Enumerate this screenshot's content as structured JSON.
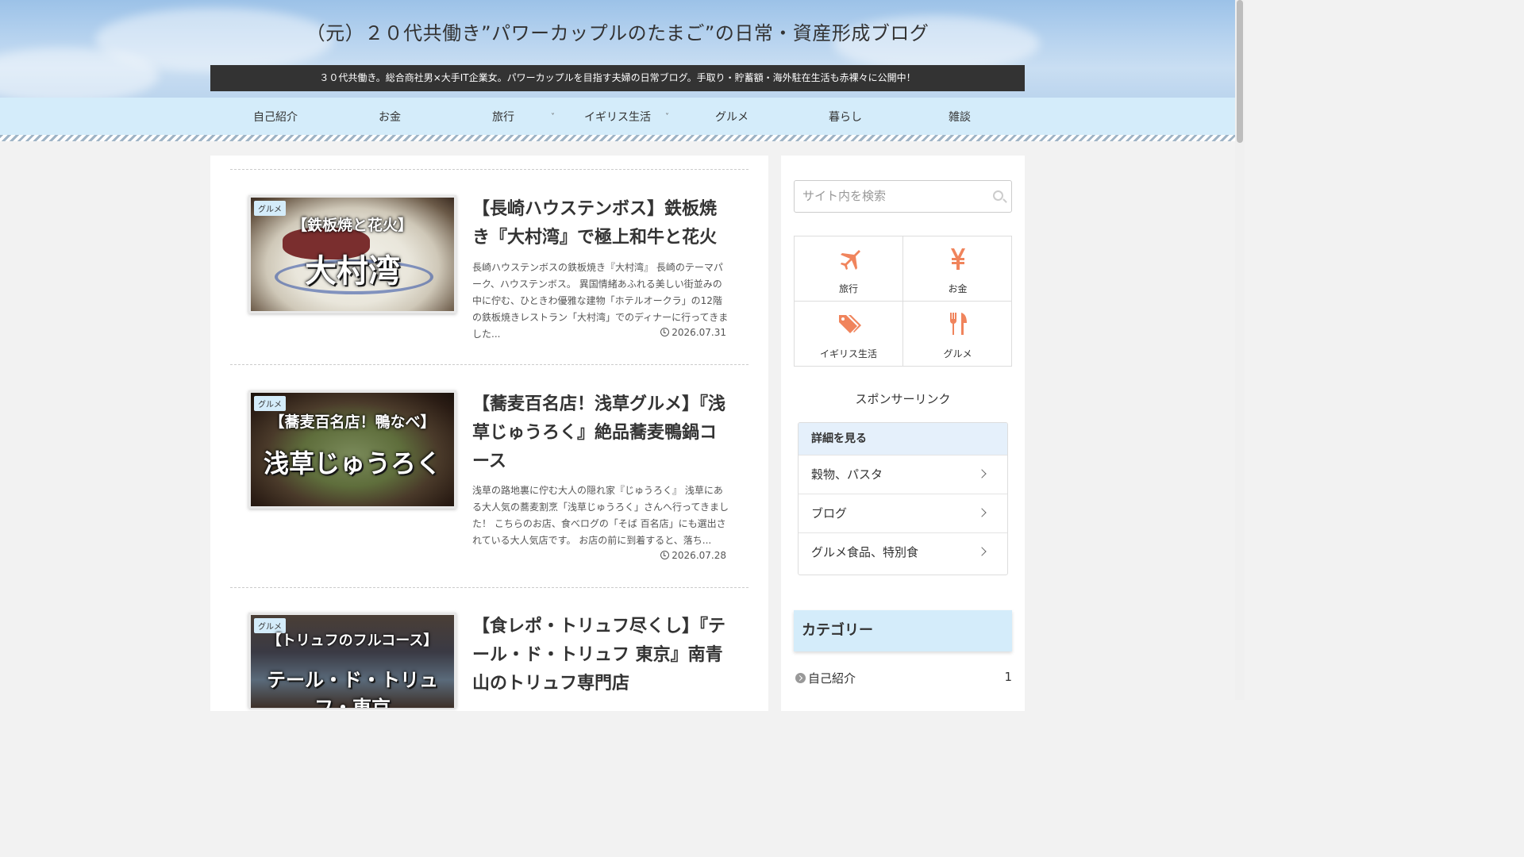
{
  "site": {
    "title": "（元）２０代共働き”パワーカップルのたまご”の日常・資産形成ブログ",
    "tagline": "３０代共働き。総合商社男×大手IT企業女。パワーカップルを目指す夫婦の日常ブログ。手取り・貯蓄額・海外駐在生活も赤裸々に公開中！"
  },
  "nav": {
    "items": [
      {
        "label": "自己紹介"
      },
      {
        "label": "お金"
      },
      {
        "label": "旅行",
        "has_submenu": true
      },
      {
        "label": "イギリス生活",
        "has_submenu": true
      },
      {
        "label": "グルメ"
      },
      {
        "label": "暮らし"
      },
      {
        "label": "雑談"
      }
    ],
    "chevron": "˅"
  },
  "posts": [
    {
      "category": "グルメ",
      "thumb_top": "【鉄板焼と花火】",
      "thumb_main": "大村湾",
      "title": "【長崎ハウステンボス】鉄板焼き『大村湾』で極上和牛と花火",
      "excerpt": "長崎ハウステンボスの鉄板焼き『大村湾』 長崎のテーマパーク、ハウステンボス。 異国情緒あふれる美しい街並みの中に佇む、ひときわ優雅な建物「ホテルオークラ」の12階の鉄板焼きレストラン「大村湾」でのディナーに行ってきました...",
      "date": "2026.07.31"
    },
    {
      "category": "グルメ",
      "thumb_top": "【蕎麦百名店！鴨なべ】",
      "thumb_main": "浅草じゅうろく",
      "title": "【蕎麦百名店！浅草グルメ】『浅草じゅうろく』絶品蕎麦鴨鍋コース",
      "excerpt": "浅草の路地裏に佇む大人の隠れ家『じゅうろく』 浅草にある大人気の蕎麦割烹「浅草じゅうろく」さんへ行ってきました！ こちらのお店、食べログの「そば 百名店」にも選出されている大人気店です。 お店の前に到着すると、落ち...",
      "date": "2026.07.28"
    },
    {
      "category": "グルメ",
      "thumb_top": "【トリュフのフルコース】",
      "thumb_main": "テール・ド・トリュフ・東京",
      "title": "【食レポ・トリュフ尽くし】『テール・ド・トリュフ 東京』南青山のトリュフ専門店",
      "excerpt": "",
      "date": ""
    }
  ],
  "sidebar": {
    "search_placeholder": "サイト内を検索",
    "tiles": [
      {
        "label": "旅行",
        "icon": "airplane-icon"
      },
      {
        "label": "お金",
        "icon": "yen-icon"
      },
      {
        "label": "イギリス生活",
        "icon": "tags-icon"
      },
      {
        "label": "グルメ",
        "icon": "utensils-icon"
      }
    ],
    "sponsor_label": "スポンサーリンク",
    "ad": {
      "heading": "詳細を見る",
      "items": [
        "穀物、パスタ",
        "ブログ",
        "グルメ食品、特別食"
      ]
    },
    "category_heading": "カテゴリー",
    "categories": [
      {
        "name": "自己紹介",
        "count": "1"
      }
    ]
  },
  "colors": {
    "accent": "#d4ecfa",
    "icon_orange": "#f0845c",
    "tagline_bg": "#333333"
  }
}
